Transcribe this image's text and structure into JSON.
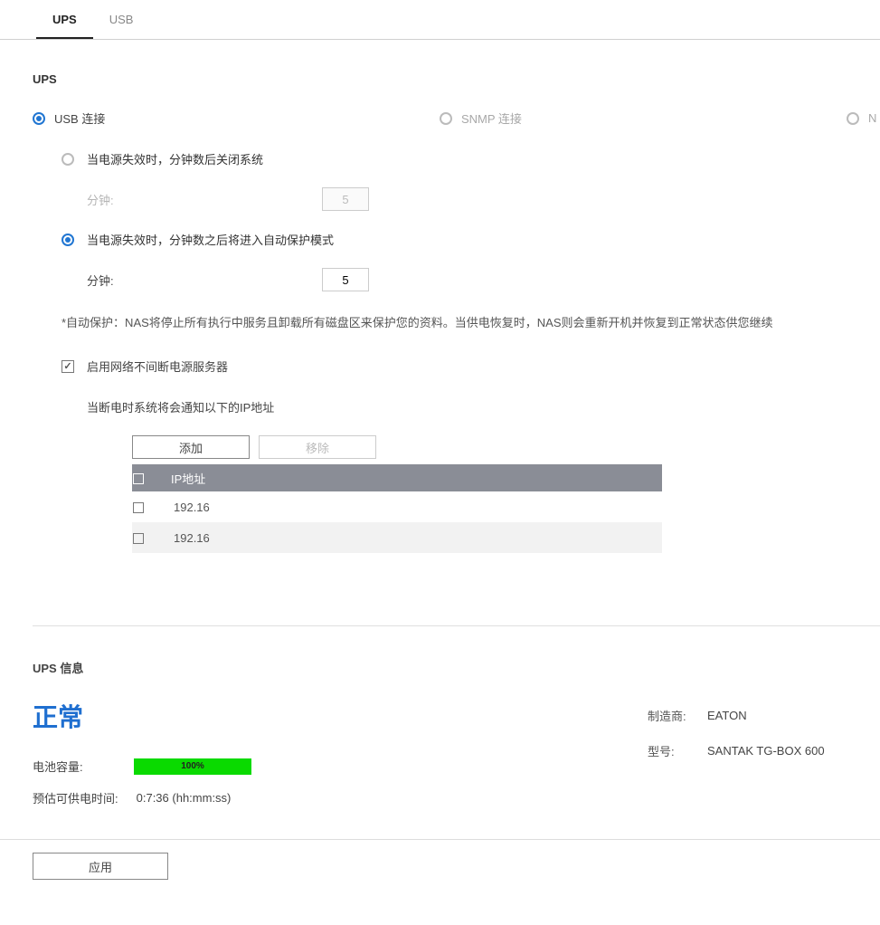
{
  "tabs": {
    "ups": "UPS",
    "usb": "USB"
  },
  "section": {
    "title": "UPS"
  },
  "conn": {
    "usb": "USB 连接",
    "snmp": "SNMP 连接",
    "other": "N"
  },
  "power": {
    "opt_shutdown": "当电源失效时，分钟数后关闭系统",
    "opt_protect": "当电源失效时，分钟数之后将进入自动保护模式",
    "minutes_label": "分钟:",
    "shutdown_minutes": "5",
    "protect_minutes": "5",
    "note": "*自动保护：NAS将停止所有执行中服务且卸载所有磁盘区来保护您的资料。当供电恢复时，NAS则会重新开机并恢复到正常状态供您继续"
  },
  "netups": {
    "enable_label": "启用网络不间断电源服务器",
    "notify_text": "当断电时系统将会通知以下的IP地址",
    "add_btn": "添加",
    "remove_btn": "移除",
    "col_ip": "IP地址",
    "rows": [
      {
        "ip": "192.16"
      },
      {
        "ip": "192.16"
      }
    ]
  },
  "info": {
    "title": "UPS 信息",
    "status": "正常",
    "battery_label": "电池容量:",
    "battery_pct": "100%",
    "est_label": "预估可供电时间:",
    "est_value": "0:7:36 (hh:mm:ss)",
    "mfr_label": "制造商:",
    "mfr_value": "EATON",
    "model_label": "型号:",
    "model_value": "SANTAK TG-BOX 600"
  },
  "footer": {
    "apply": "应用"
  }
}
